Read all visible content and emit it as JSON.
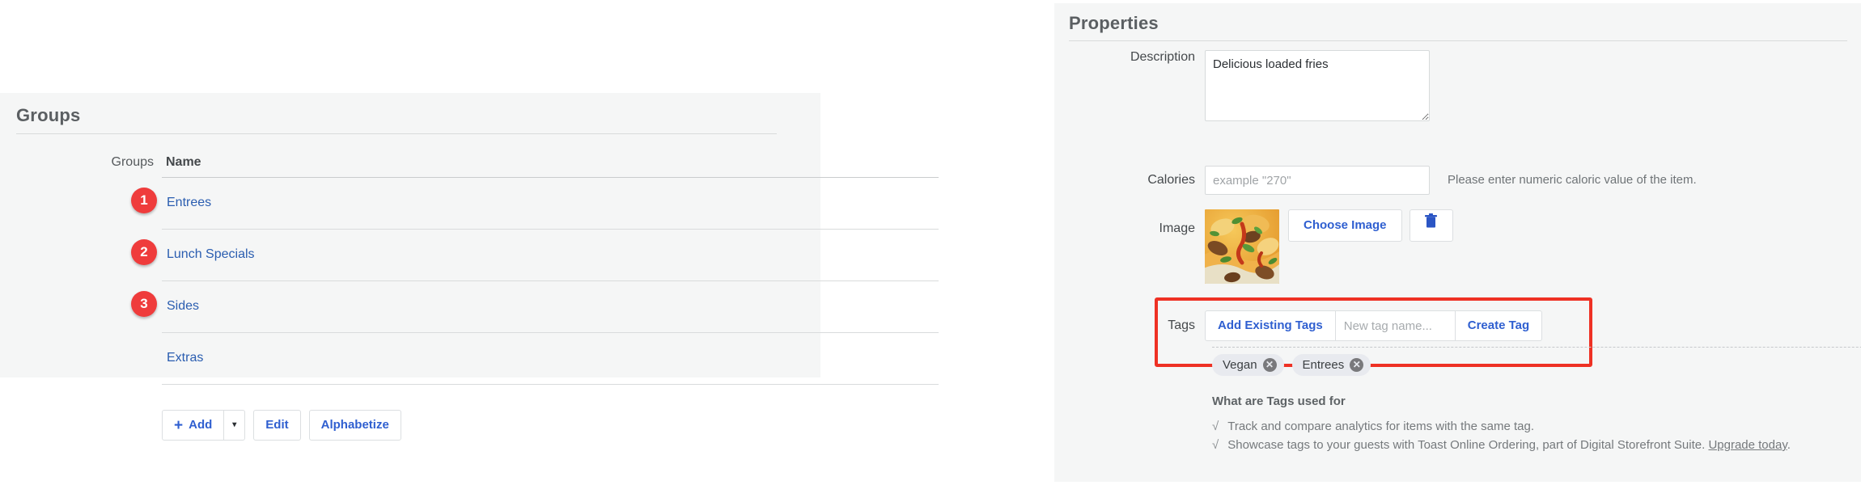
{
  "groups_card": {
    "title": "Groups",
    "table": {
      "columns": {
        "groups": "Groups",
        "name": "Name"
      },
      "rows": [
        {
          "badge": "1",
          "name": "Entrees"
        },
        {
          "badge": "2",
          "name": "Lunch Specials"
        },
        {
          "badge": "3",
          "name": "Sides"
        },
        {
          "badge": "",
          "name": "Extras"
        }
      ]
    },
    "actions": {
      "add_label": "Add",
      "add_plus": "+",
      "add_caret": "▾",
      "edit_label": "Edit",
      "alphabetize_label": "Alphabetize"
    }
  },
  "properties_panel": {
    "title": "Properties",
    "description": {
      "label": "Description",
      "value": "Delicious loaded fries",
      "placeholder": ""
    },
    "calories": {
      "label": "Calories",
      "value": "",
      "placeholder": "example \"270\"",
      "help_text": "Please enter numeric caloric value of the item."
    },
    "image": {
      "label": "Image",
      "choose_label": "Choose Image",
      "delete_icon": "trash-icon"
    },
    "tags": {
      "label": "Tags",
      "add_existing_label": "Add Existing Tags",
      "new_tag_value": "",
      "new_tag_placeholder": "New tag name...",
      "create_tag_label": "Create Tag",
      "chips": [
        {
          "label": "Vegan",
          "remove": "✕"
        },
        {
          "label": "Entrees",
          "remove": "✕"
        }
      ],
      "highlight_color": "#ee3124"
    },
    "tags_info": {
      "title": "What are Tags used for",
      "check": "√",
      "lines": [
        "Track and compare analytics for items with the same tag.",
        "Showcase tags to your guests with Toast Online Ordering, part of Digital Storefront Suite."
      ],
      "upgrade_link": "Upgrade today",
      "upgrade_suffix": "."
    }
  },
  "colors": {
    "badge_red": "#ef3c3c",
    "link_blue": "#2a5db0",
    "button_blue": "#2f5fd0",
    "panel_bg": "#f5f6f6",
    "highlight_red": "#ee3124"
  }
}
